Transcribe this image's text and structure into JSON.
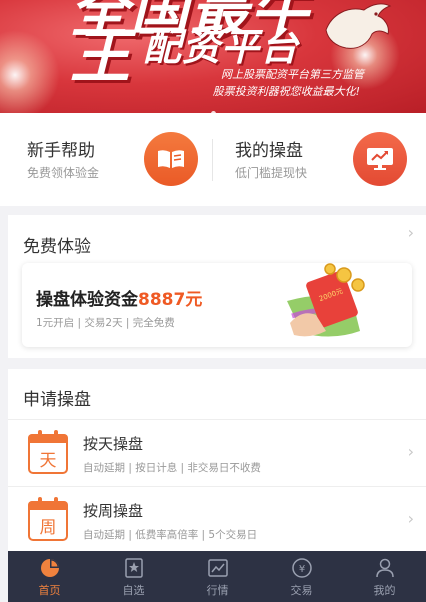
{
  "banner": {
    "top_text": "全国最牛",
    "big_char": "王",
    "headline": "配资平台",
    "sub1": "网上股票配资平台第三方监管",
    "sub2": "股票投资利器祝您收益最大化!"
  },
  "quick": {
    "left": {
      "title": "新手帮助",
      "subtitle": "免费领体验金",
      "icon": "book-icon"
    },
    "right": {
      "title": "我的操盘",
      "subtitle": "低门槛提现快",
      "icon": "chart-screen-icon"
    }
  },
  "trial": {
    "section_title": "免费体验",
    "card_title": "操盘体验资金",
    "card_amount": "8887元",
    "card_sub": "1元开启 | 交易2天 | 完全免费",
    "art_text": "2000元"
  },
  "apply": {
    "section_title": "申请操盘",
    "rows": [
      {
        "icon_char": "天",
        "title": "按天操盘",
        "subtitle": "自动延期 | 按日计息 | 非交易日不收费"
      },
      {
        "icon_char": "周",
        "title": "按周操盘",
        "subtitle": "自动延期 | 低费率高倍率 | 5个交易日"
      }
    ]
  },
  "nav": {
    "items": [
      {
        "label": "首页",
        "icon": "home-pie-icon",
        "active": true
      },
      {
        "label": "自选",
        "icon": "star-bookmark-icon",
        "active": false
      },
      {
        "label": "行情",
        "icon": "trend-icon",
        "active": false
      },
      {
        "label": "交易",
        "icon": "yen-coin-icon",
        "active": false
      },
      {
        "label": "我的",
        "icon": "user-icon",
        "active": false
      }
    ]
  },
  "colors": {
    "accent": "#ef5a24",
    "banner_red": "#d8363c",
    "nav_bg": "#2d3244",
    "nav_active": "#f0823e"
  }
}
